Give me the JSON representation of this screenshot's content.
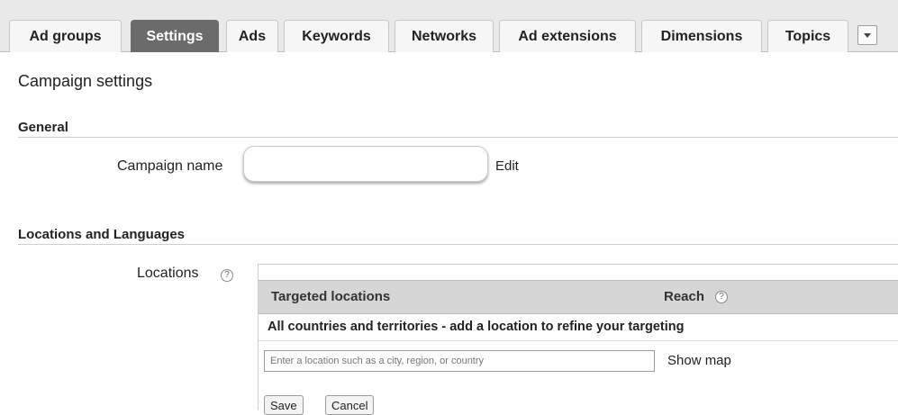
{
  "tabs": [
    {
      "label": "Ad groups",
      "active": false
    },
    {
      "label": "Settings",
      "active": true
    },
    {
      "label": "Ads",
      "active": false
    },
    {
      "label": "Keywords",
      "active": false
    },
    {
      "label": "Networks",
      "active": false
    },
    {
      "label": "Ad extensions",
      "active": false
    },
    {
      "label": "Dimensions",
      "active": false
    },
    {
      "label": "Topics",
      "active": false
    }
  ],
  "tab_more_icon": "chevron-down-icon",
  "page_title": "Campaign settings",
  "general": {
    "heading": "General",
    "campaign_name_label": "Campaign name",
    "campaign_name_value": "",
    "edit_link": "Edit"
  },
  "locations_languages": {
    "heading": "Locations and Languages",
    "locations_label": "Locations",
    "help_glyph": "?",
    "table": {
      "col_targeted": "Targeted locations",
      "col_reach": "Reach",
      "note": "All countries and territories - add a location to refine your targeting"
    },
    "location_input_placeholder": "Enter a location such as a city, region, or country",
    "show_map": "Show map",
    "save_label": "Save",
    "cancel_label": "Cancel"
  },
  "colors": {
    "active_tab": "#6b6b6b",
    "tab_bar": "#e9e9e9",
    "table_header": "#d6d6d6"
  }
}
